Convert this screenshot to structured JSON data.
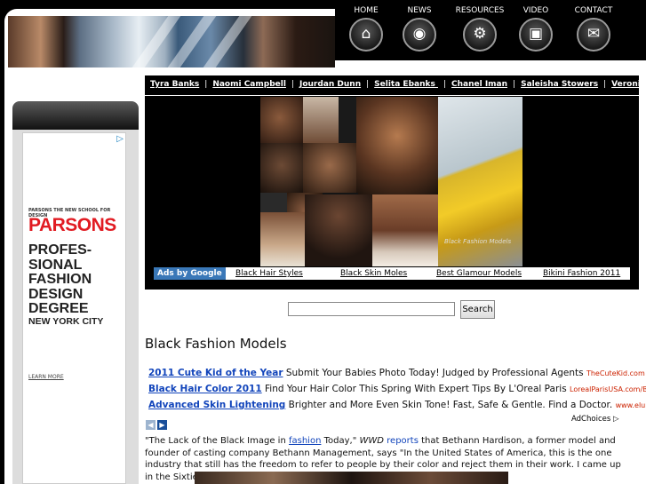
{
  "nav": [
    {
      "label": "HOME",
      "icon": "home-icon",
      "glyph": "⌂"
    },
    {
      "label": "NEWS",
      "icon": "rss-icon",
      "glyph": "◉"
    },
    {
      "label": "RESOURCES",
      "icon": "gear-icon",
      "glyph": "⚙"
    },
    {
      "label": "VIDEO",
      "icon": "camera-icon",
      "glyph": "▣"
    },
    {
      "label": "CONTACT",
      "icon": "mail-icon",
      "glyph": "✉"
    }
  ],
  "models": [
    "Tyra Banks",
    "Naomi Campbell",
    "Jourdan Dunn",
    "Selita Ebanks ",
    "Chanel Iman",
    "Saleisha Stowers",
    "Veronica"
  ],
  "left_ad": {
    "tagline": "PARSONS THE NEW SCHOOL FOR DESIGN",
    "logo": "PARSONS",
    "title": "PROFES-SIONAL FASHION DESIGN DEGREE",
    "city": "NEW YORK CITY",
    "more": "LEARN MORE",
    "brand_color": "#e11b22"
  },
  "collage_caption": "Black Fashion Models",
  "ad_links": {
    "label": "Ads by Google",
    "links": [
      "Black Hair Styles",
      "Black Skin Moles",
      "Best Glamour Models",
      "Bikini Fashion 2011"
    ]
  },
  "search": {
    "button": "Search",
    "value": ""
  },
  "page_title": "Black Fashion Models",
  "text_ads": [
    {
      "title": "2011 Cute Kid of the Year",
      "body": "Submit Your Babies Photo Today! Judged by Professional Agents",
      "url": "TheCuteKid.com"
    },
    {
      "title": "Black Hair Color 2011",
      "body": "Find Your Hair Color This Spring With Expert Tips By L'Oreal Paris",
      "url": "LorealParisUSA.com/Black+H.."
    },
    {
      "title": "Advanced Skin Lightening",
      "body": "Brighter and More Even Skin Tone! Fast, Safe & Gentle. Find a Doctor.",
      "url": "www.elureskin...."
    }
  ],
  "adchoices": "AdChoices ▷",
  "article": {
    "p1": "\"The Lack of the Black Image in ",
    "link": "fashion",
    "p2": " Today,\" ",
    "wwd": "WWD",
    "reports": " reports",
    "p3": " that Bethann Hardison, a former model and founder of casting company Bethann Management, says \"In the United States of America, this is the one industry that still has the freedom to refer to people by their color and reject them in their work. I came up in the Sixties. I feel it's the worst it's"
  },
  "colors": {
    "link": "#1144bb",
    "ad_url": "#cc2200",
    "ads_by_google_bg": "#3a78b8"
  }
}
